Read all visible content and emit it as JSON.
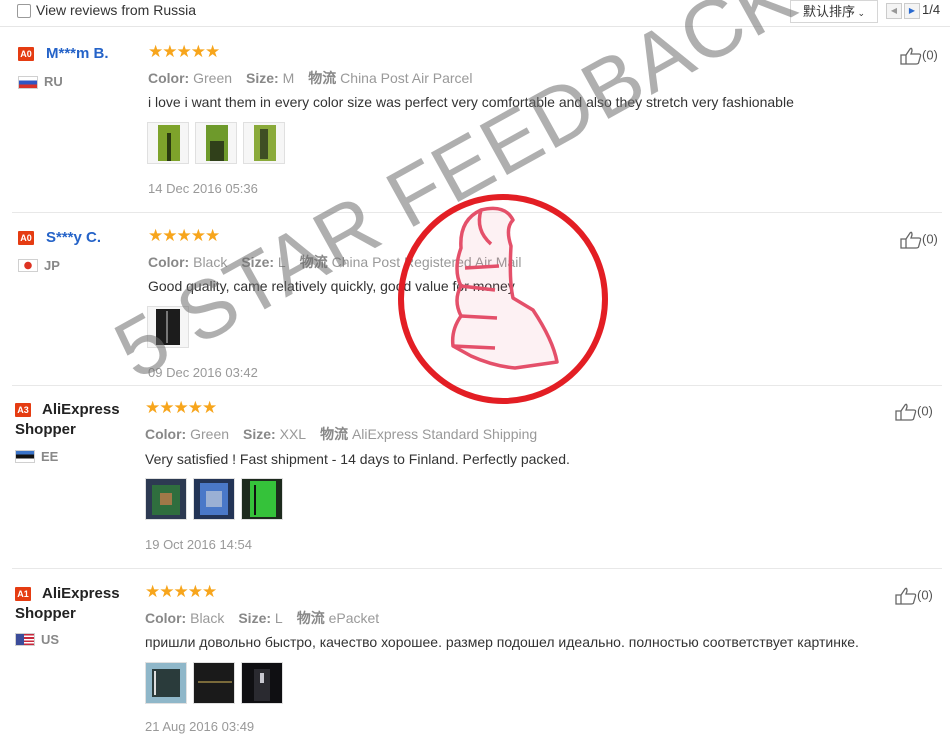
{
  "toolbar": {
    "filter_label": "View reviews from Russia",
    "sort_label": "默认排序",
    "page_indicator": "1/4"
  },
  "meta_labels": {
    "color": "Color:",
    "size": "Size:",
    "shipping": "物流"
  },
  "reviews": [
    {
      "level": "A0",
      "name": "M***m B.",
      "country": "RU",
      "stars": "★★★★★",
      "color": "Green",
      "size": "M",
      "shipping": "China Post Air Parcel",
      "text": "i love i want them in every color size was perfect very comfortable and also they stretch very fashionable",
      "date": "14 Dec 2016 05:36",
      "likes": "(0)"
    },
    {
      "level": "A0",
      "name": "S***y C.",
      "country": "JP",
      "stars": "★★★★★",
      "color": "Black",
      "size": "L",
      "shipping": "China Post Registered Air Mail",
      "text": "Good quality, came relatively quickly, good value for money",
      "date": "09 Dec 2016 03:42",
      "likes": "(0)"
    },
    {
      "level": "A3",
      "name": "AliExpress Shopper",
      "country": "EE",
      "stars": "★★★★★",
      "color": "Green",
      "size": "XXL",
      "shipping": "AliExpress Standard Shipping",
      "text": "Very satisfied ! Fast shipment - 14 days to Finland. Perfectly packed.",
      "date": "19 Oct 2016 14:54",
      "likes": "(0)"
    },
    {
      "level": "A1",
      "name": "AliExpress Shopper",
      "country": "US",
      "stars": "★★★★★",
      "color": "Black",
      "size": "L",
      "shipping": "ePacket",
      "text": "пришли довольно быстро, качество хорошее. размер подошел идеально. полностью соответствует картинке.",
      "date": "21 Aug 2016 03:49",
      "likes": "(0)"
    }
  ],
  "watermark": {
    "text": "5 STAR FEEDBACK",
    "color": "#e31e24"
  }
}
